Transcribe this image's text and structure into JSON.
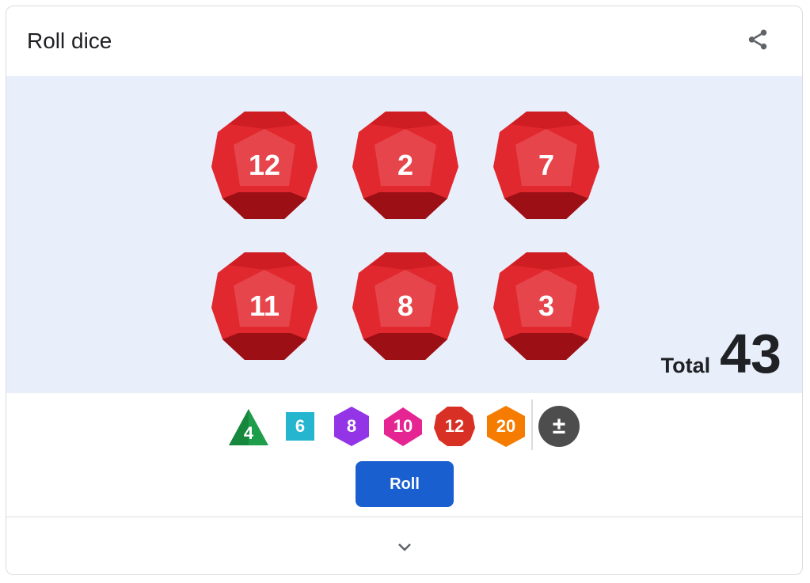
{
  "widget": {
    "title": "Roll dice"
  },
  "icons": {
    "share": "share-icon",
    "expand": "chevron-down-icon",
    "modifier": "plus-minus-icon"
  },
  "dice": [
    {
      "value": "12"
    },
    {
      "value": "2"
    },
    {
      "value": "7"
    },
    {
      "value": "11"
    },
    {
      "value": "8"
    },
    {
      "value": "3"
    }
  ],
  "total": {
    "label": "Total",
    "value": "43"
  },
  "die_types": [
    {
      "label": "4",
      "shape": "triangle",
      "color": "#1e9e4a"
    },
    {
      "label": "6",
      "shape": "square",
      "color": "#25b5cf"
    },
    {
      "label": "8",
      "shape": "hexagon",
      "color": "#9334e6"
    },
    {
      "label": "10",
      "shape": "diamond-hex",
      "color": "#e52592"
    },
    {
      "label": "12",
      "shape": "octagon",
      "color": "#d93025"
    },
    {
      "label": "20",
      "shape": "hexagon",
      "color": "#f57c00"
    }
  ],
  "modifier": {
    "label": "±"
  },
  "roll_button": {
    "label": "Roll"
  },
  "colors": {
    "die_fill": "#e0282e",
    "board_bg": "#e8eefa",
    "accent": "#1a5fd0"
  }
}
